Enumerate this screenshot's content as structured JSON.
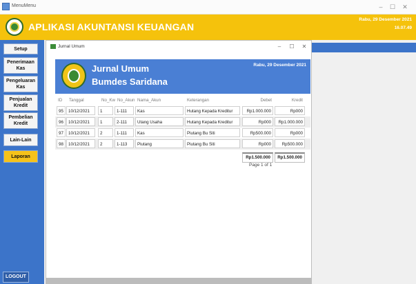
{
  "window": {
    "title": "MenuMenu",
    "min": "–",
    "max": "☐",
    "close": "✕"
  },
  "header": {
    "app_name": "APLIKASI AKUNTANSI KEUANGAN",
    "date": "Rabu, 29 Desember 2021",
    "time": "16.07.49"
  },
  "sidebar": {
    "items": [
      {
        "label": "Setup",
        "active": false
      },
      {
        "label": "Penerimaan Kas",
        "active": false
      },
      {
        "label": "Pengeluaran Kas",
        "active": false
      },
      {
        "label": "Penjualan Kredit",
        "active": false
      },
      {
        "label": "Pembelian Kredit",
        "active": false
      },
      {
        "label": "Lain-Lain",
        "active": false
      },
      {
        "label": "Laporan",
        "active": true
      }
    ],
    "logout": "LOGOUT"
  },
  "child": {
    "title": "Jurnal Umum",
    "min": "–",
    "max": "☐",
    "close": "✕"
  },
  "report": {
    "title1": "Jurnal Umum",
    "title2": "Bumdes Saridana",
    "date": "Rabu, 29 Desember 2021",
    "columns": [
      "ID",
      "Tanggal",
      "No_Kw",
      "No_Akun",
      "Nama_Akun",
      "Keterangan",
      "Debet",
      "Kredit"
    ],
    "rows": [
      [
        "95",
        "10/12/2021",
        "1",
        "1-111",
        "Kas",
        "Hutang Kepada Kreditur",
        "Rp1.000.000",
        "Rp000"
      ],
      [
        "96",
        "10/12/2021",
        "1",
        "2-111",
        "Utang Usaha",
        "Hutang Kepada Kreditur",
        "Rp000",
        "Rp1.000.000"
      ],
      [
        "97",
        "10/12/2021",
        "2",
        "1-111",
        "Kas",
        "Piutang Bu Siti",
        "Rp500.000",
        "Rp000"
      ],
      [
        "98",
        "10/12/2021",
        "2",
        "1-113",
        "Piutang",
        "Piutang Bu Siti",
        "Rp000",
        "Rp500.000"
      ]
    ],
    "total_debet": "Rp1.500.000",
    "total_kredit": "Rp1.500.000",
    "page_info": "Page 1 of 1"
  }
}
